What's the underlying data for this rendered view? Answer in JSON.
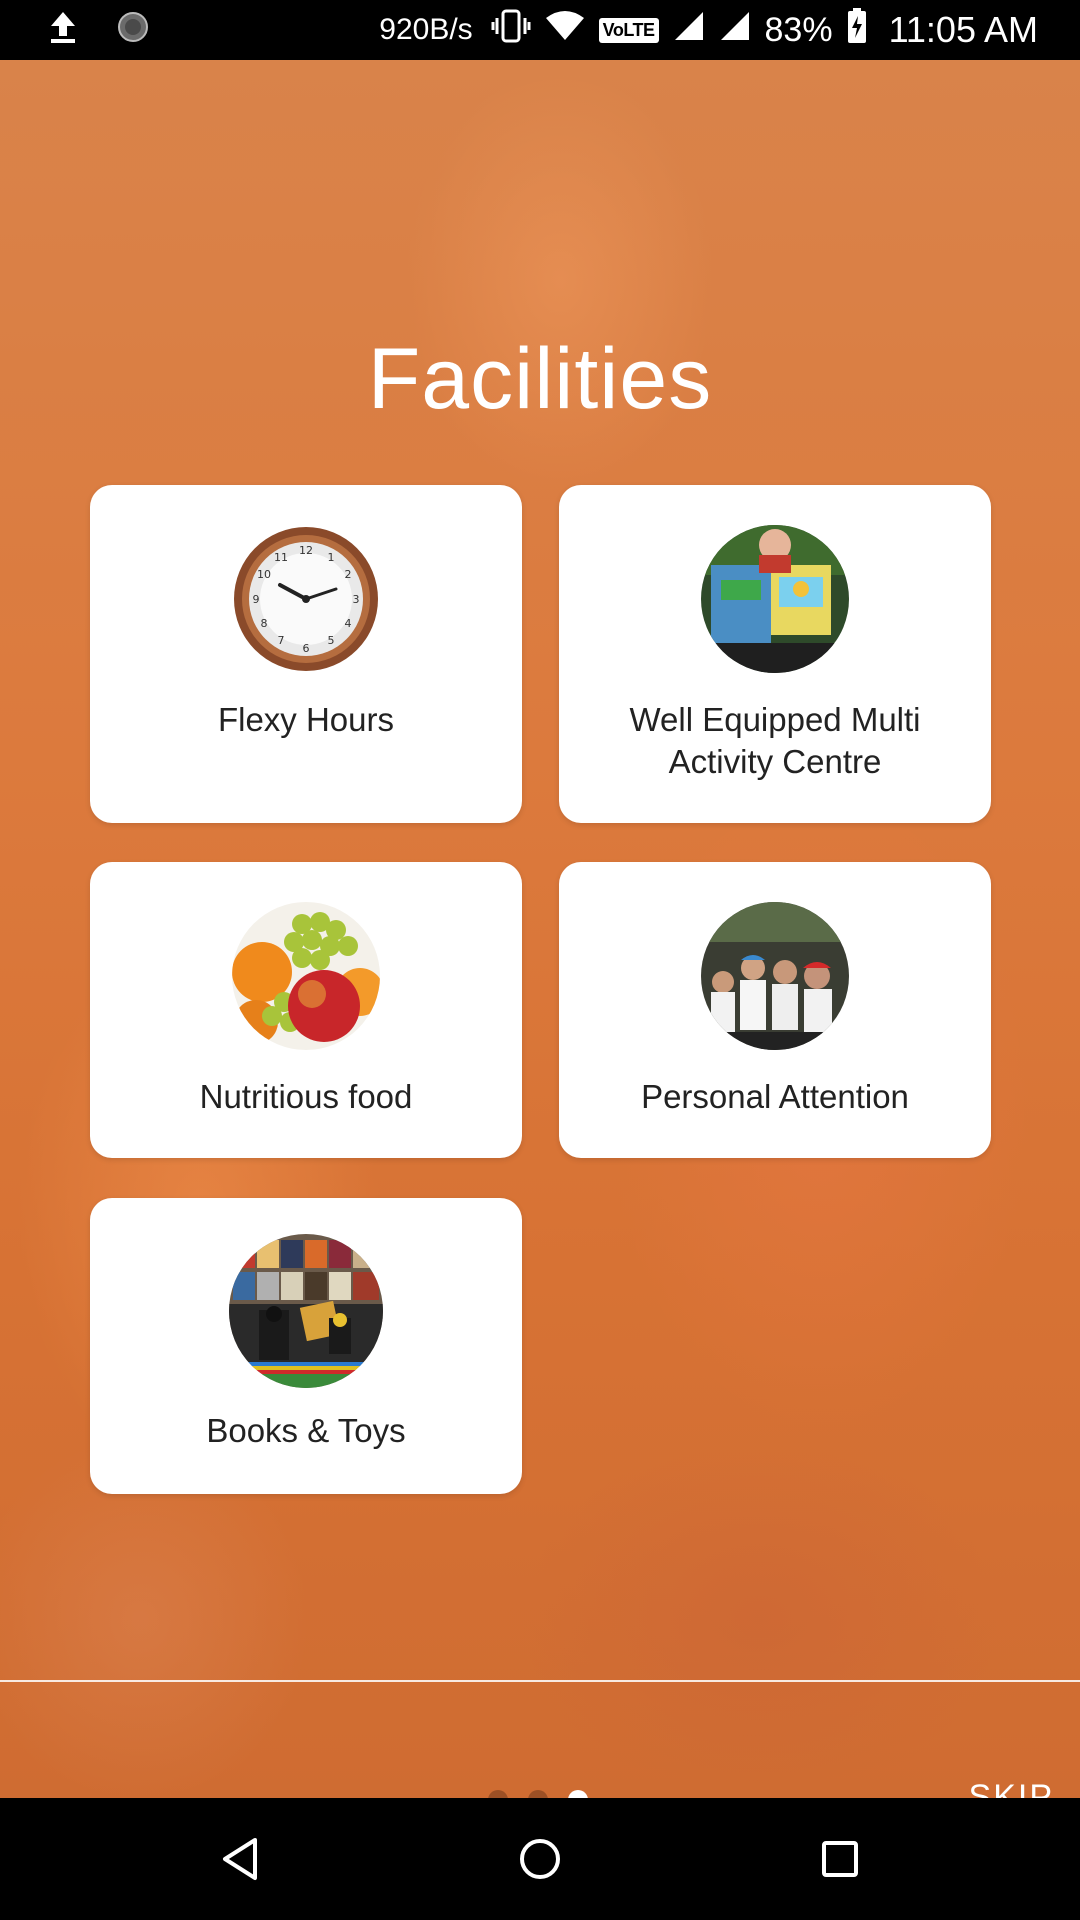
{
  "status_bar": {
    "net_speed": "920B/s",
    "volte": "VoLTE",
    "battery": "83%",
    "time": "11:05 AM",
    "icons": [
      "upload-icon",
      "sync-icon",
      "vibrate-icon",
      "wifi-icon",
      "signal-icon",
      "signal-icon",
      "battery-charging-icon"
    ]
  },
  "page": {
    "title": "Facilities"
  },
  "facilities": [
    {
      "label": "Flexy Hours",
      "icon": "clock-icon"
    },
    {
      "label": "Well Equipped Multi Activity Centre",
      "icon": "activity-centre-photo"
    },
    {
      "label": "Nutritious food",
      "icon": "fruits-photo"
    },
    {
      "label": "Personal Attention",
      "icon": "children-photo"
    },
    {
      "label": "Books & Toys",
      "icon": "books-toys-photo"
    }
  ],
  "pager": {
    "total": 3,
    "active_index": 2
  },
  "footer": {
    "skip_label": "SKIP"
  },
  "colors": {
    "background": "#d87a3e",
    "card": "#ffffff",
    "text_dark": "#222222"
  }
}
